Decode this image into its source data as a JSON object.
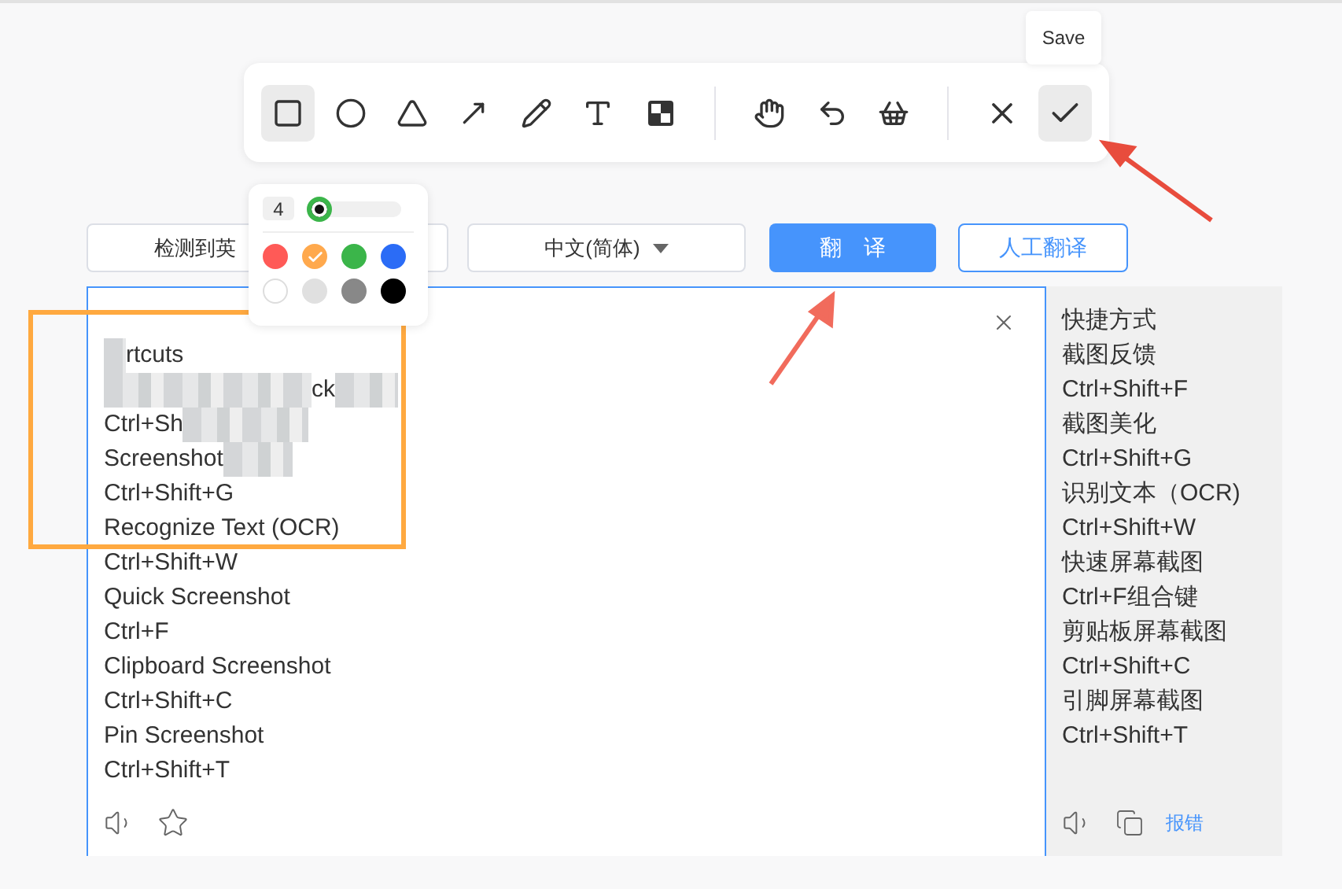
{
  "toolbar": {
    "tool_groups": [
      [
        {
          "kind": "rectangle",
          "selected": true
        },
        {
          "kind": "ellipse",
          "selected": false
        },
        {
          "kind": "triangle",
          "selected": false
        },
        {
          "kind": "arrow",
          "selected": false
        },
        {
          "kind": "pencil",
          "selected": false
        },
        {
          "kind": "text",
          "selected": false
        },
        {
          "kind": "mosaic",
          "selected": false
        }
      ],
      [
        {
          "kind": "hand",
          "selected": false
        },
        {
          "kind": "undo",
          "selected": false
        },
        {
          "kind": "clear",
          "selected": false
        }
      ],
      [
        {
          "kind": "cancel",
          "selected": false
        },
        {
          "kind": "save",
          "selected": true
        }
      ]
    ],
    "tooltip": "Save"
  },
  "brush_popover": {
    "size": "4",
    "level": 0.0,
    "colors": [
      {
        "color": "#ff5a57",
        "selected": false
      },
      {
        "color": "#ffa94d",
        "selected": true
      },
      {
        "color": "#3bb54a",
        "selected": false
      },
      {
        "color": "#2b6cf6",
        "selected": false
      },
      {
        "color": "#ffffff",
        "selected": false
      },
      {
        "color": "#e0e0e0",
        "selected": false
      },
      {
        "color": "#888888",
        "selected": false
      },
      {
        "color": "#000000",
        "selected": false
      }
    ]
  },
  "language_bar": {
    "source_language": "检测到英",
    "target_language": "中文(简体)",
    "translate_button": "翻　译",
    "human_translate_button": "人工翻译"
  },
  "source_text": {
    "lines": [
      {
        "text": "rtcuts",
        "blurred_before": true,
        "blurred_after": false
      },
      {
        "text": "ck",
        "blurred_before": true,
        "blurred_after": true
      },
      {
        "text": "Ctrl+Sh",
        "blurred_before": false,
        "blurred_after": true
      },
      {
        "text": "Screenshot",
        "blurred_before": false,
        "blurred_after": true
      },
      {
        "text": "Ctrl+Shift+G",
        "blurred_before": false,
        "blurred_after": false
      },
      {
        "text": "Recognize Text (OCR)",
        "blurred_before": false,
        "blurred_after": false
      },
      {
        "text": "Ctrl+Shift+W",
        "blurred_before": false,
        "blurred_after": false
      },
      {
        "text": "Quick Screenshot",
        "blurred_before": false,
        "blurred_after": false
      },
      {
        "text": "Ctrl+F",
        "blurred_before": false,
        "blurred_after": false
      },
      {
        "text": "Clipboard Screenshot",
        "blurred_before": false,
        "blurred_after": false
      },
      {
        "text": "Ctrl+Shift+C",
        "blurred_before": false,
        "blurred_after": false
      },
      {
        "text": "Pin Screenshot",
        "blurred_before": false,
        "blurred_after": false
      },
      {
        "text": "Ctrl+Shift+T",
        "blurred_before": false,
        "blurred_after": false
      }
    ]
  },
  "result_text": {
    "lines": [
      "快捷方式",
      "截图反馈",
      "Ctrl+Shift+F",
      "截图美化",
      "Ctrl+Shift+G",
      "识别文本（OCR)",
      "Ctrl+Shift+W",
      "快速屏幕截图",
      "Ctrl+F组合键",
      "剪贴板屏幕截图",
      "Ctrl+Shift+C",
      "引脚屏幕截图",
      "Ctrl+Shift+T"
    ],
    "report_link": "报错"
  }
}
